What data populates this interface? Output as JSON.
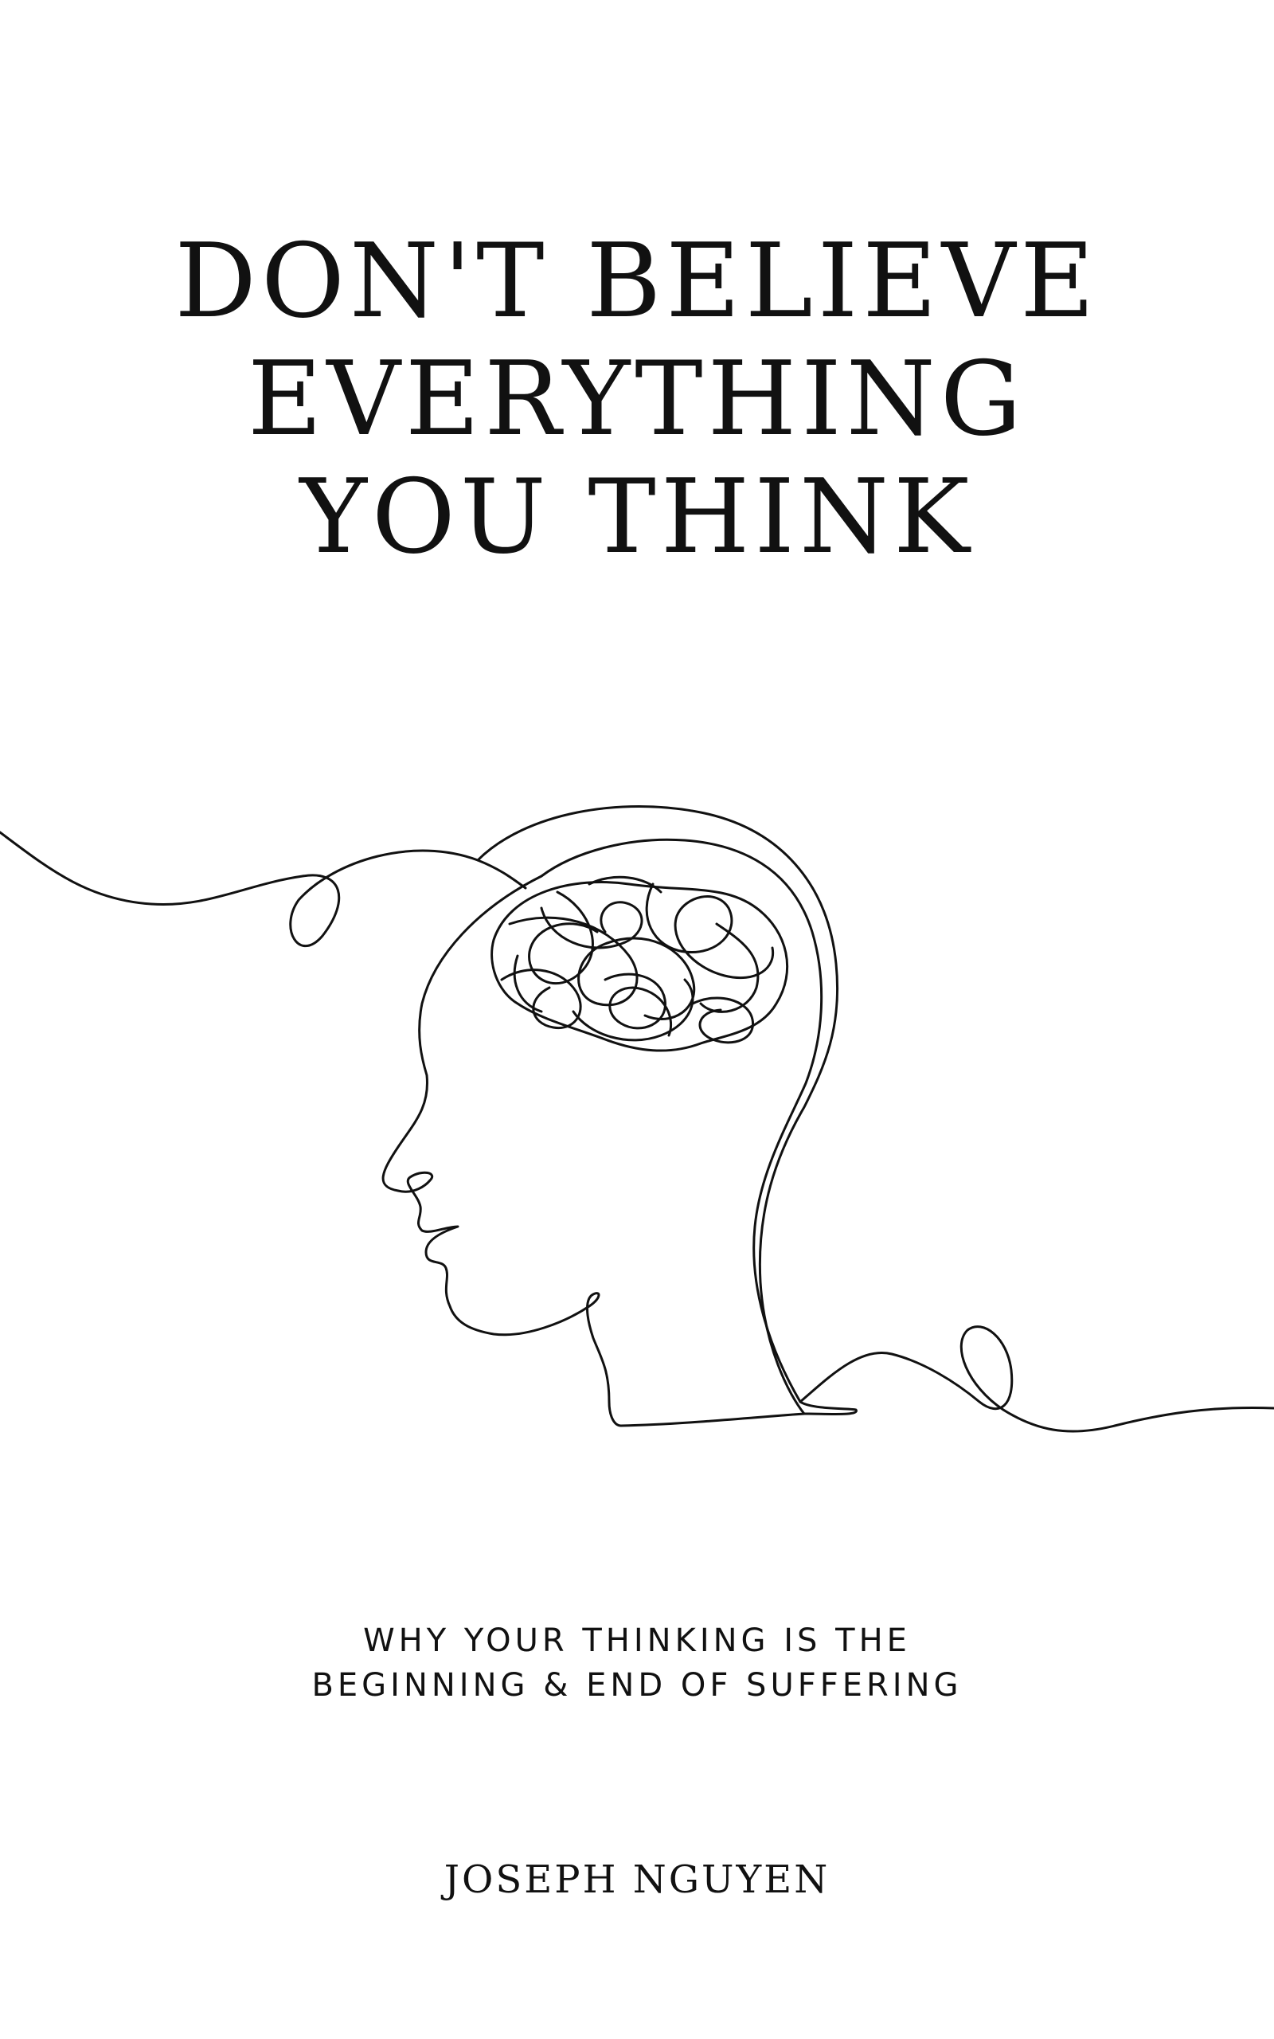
{
  "cover": {
    "title_lines": [
      "DON'T BELIEVE",
      "EVERYTHING",
      "YOU THINK"
    ],
    "subtitle_lines": [
      "WHY YOUR THINKING IS THE",
      "BEGINNING & END OF SUFFERING"
    ],
    "author": "JOSEPH NGUYEN",
    "illustration": "line-drawing-head-tangled-brain-icon",
    "colors": {
      "background": "#ffffff",
      "ink": "#111111"
    }
  }
}
